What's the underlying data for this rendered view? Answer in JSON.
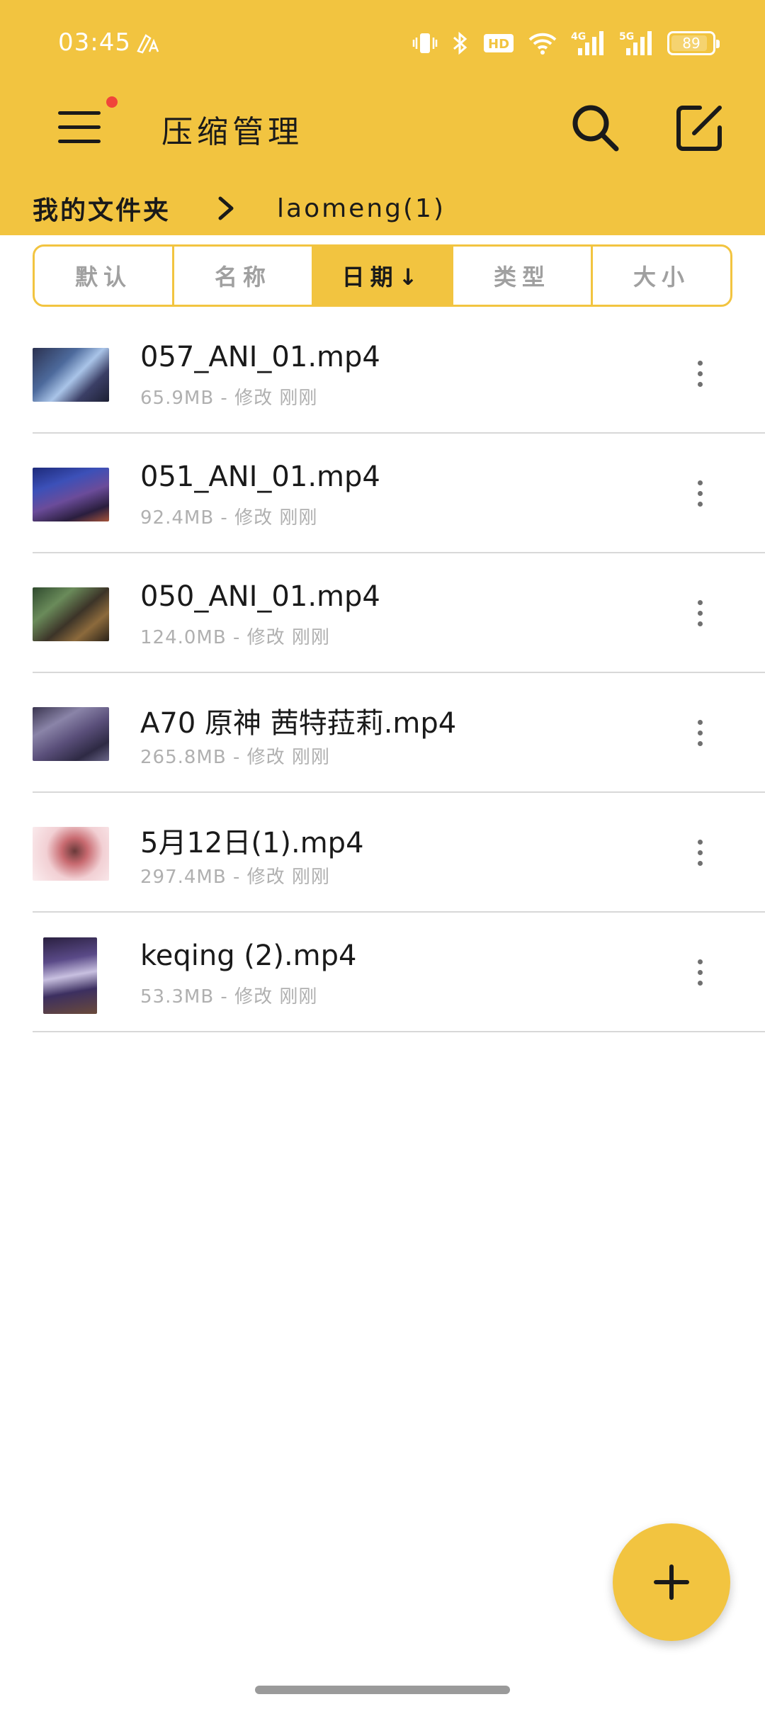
{
  "status_bar": {
    "time": "03:45",
    "network_4g": "4G",
    "network_5g": "5G",
    "battery": "89",
    "battery_level": 0.89,
    "icons": [
      "font-a-icon",
      "vibrate-icon",
      "bluetooth-icon",
      "hd-icon",
      "wifi-icon",
      "signal-4g-icon",
      "signal-5g-icon",
      "battery-icon"
    ]
  },
  "header": {
    "title": "压缩管理",
    "menu_has_notification": true,
    "icons": [
      "menu-icon",
      "search-icon",
      "edit-icon"
    ]
  },
  "breadcrumb": {
    "root": "我的文件夹",
    "current": "laomeng(1)"
  },
  "sort_tabs": [
    {
      "label": "默认",
      "active": false
    },
    {
      "label": "名称",
      "active": false
    },
    {
      "label": "日期↓",
      "active": true
    },
    {
      "label": "类型",
      "active": false
    },
    {
      "label": "大小",
      "active": false
    }
  ],
  "files": [
    {
      "name": "057_ANI_01.mp4",
      "meta": "65.9MB - 修改 刚刚",
      "thumb_orientation": "landscape"
    },
    {
      "name": "051_ANI_01.mp4",
      "meta": "92.4MB - 修改 刚刚",
      "thumb_orientation": "landscape"
    },
    {
      "name": "050_ANI_01.mp4",
      "meta": "124.0MB - 修改 刚刚",
      "thumb_orientation": "landscape"
    },
    {
      "name": "A70 原神 茜特菈莉.mp4",
      "meta": "265.8MB - 修改 刚刚",
      "thumb_orientation": "landscape"
    },
    {
      "name": "5月12日(1).mp4",
      "meta": "297.4MB - 修改 刚刚",
      "thumb_orientation": "landscape"
    },
    {
      "name": "keqing (2).mp4",
      "meta": "53.3MB - 修改 刚刚",
      "thumb_orientation": "portrait"
    }
  ],
  "fab": {
    "icon": "plus-icon"
  },
  "colors": {
    "accent": "#f2c440",
    "text_primary": "#1a1a1a",
    "text_secondary": "#b0b0b0",
    "divider": "#d8d8d8",
    "notification_dot": "#f0453a"
  }
}
